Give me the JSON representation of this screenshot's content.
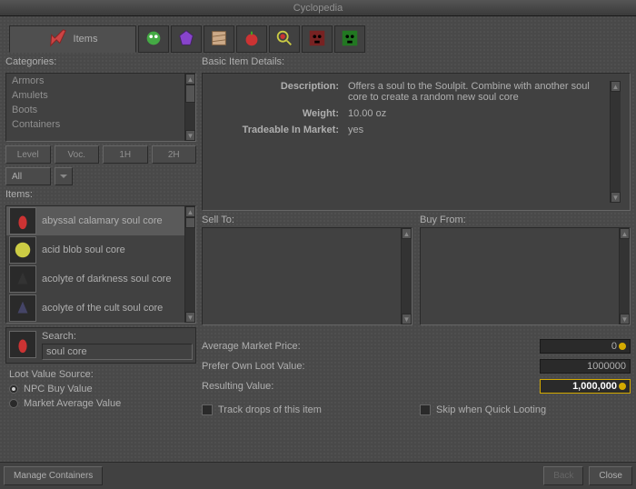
{
  "window": {
    "title": "Cyclopedia"
  },
  "tabs": {
    "active_label": "Items"
  },
  "sidebar": {
    "categories_label": "Categories:",
    "categories": [
      "Armors",
      "Amulets",
      "Boots",
      "Containers"
    ],
    "filters": {
      "level": "Level",
      "voc": "Voc.",
      "oneh": "1H",
      "twoh": "2H",
      "all": "All"
    },
    "items_label": "Items:",
    "items": [
      {
        "label": "abyssal calamary soul core"
      },
      {
        "label": "acid blob soul core"
      },
      {
        "label": "acolyte of darkness soul core"
      },
      {
        "label": "acolyte of the cult soul core"
      }
    ],
    "selected_index": 0,
    "search_label": "Search:",
    "search_value": "soul core",
    "loot_label": "Loot Value Source:",
    "loot_options": {
      "npc": "NPC Buy Value",
      "market": "Market Average Value"
    },
    "loot_selected": "npc"
  },
  "details": {
    "title": "Basic Item Details:",
    "rows": {
      "desc_k": "Description:",
      "desc_v": "Offers a soul to the Soulpit. Combine with another soul core to create a random new soul core",
      "weight_k": "Weight:",
      "weight_v": "10.00 oz",
      "trade_k": "Tradeable In Market:",
      "trade_v": "yes"
    }
  },
  "trade": {
    "sell": "Sell To:",
    "buy": "Buy From:"
  },
  "stats": {
    "avg_k": "Average Market Price:",
    "avg_v": "0",
    "pref_k": "Prefer Own Loot Value:",
    "pref_v": "1000000",
    "res_k": "Resulting Value:",
    "res_v": "1,000,000"
  },
  "checks": {
    "track": "Track drops of this item",
    "skip": "Skip when Quick Looting"
  },
  "footer": {
    "manage": "Manage Containers",
    "back": "Back",
    "close": "Close"
  }
}
